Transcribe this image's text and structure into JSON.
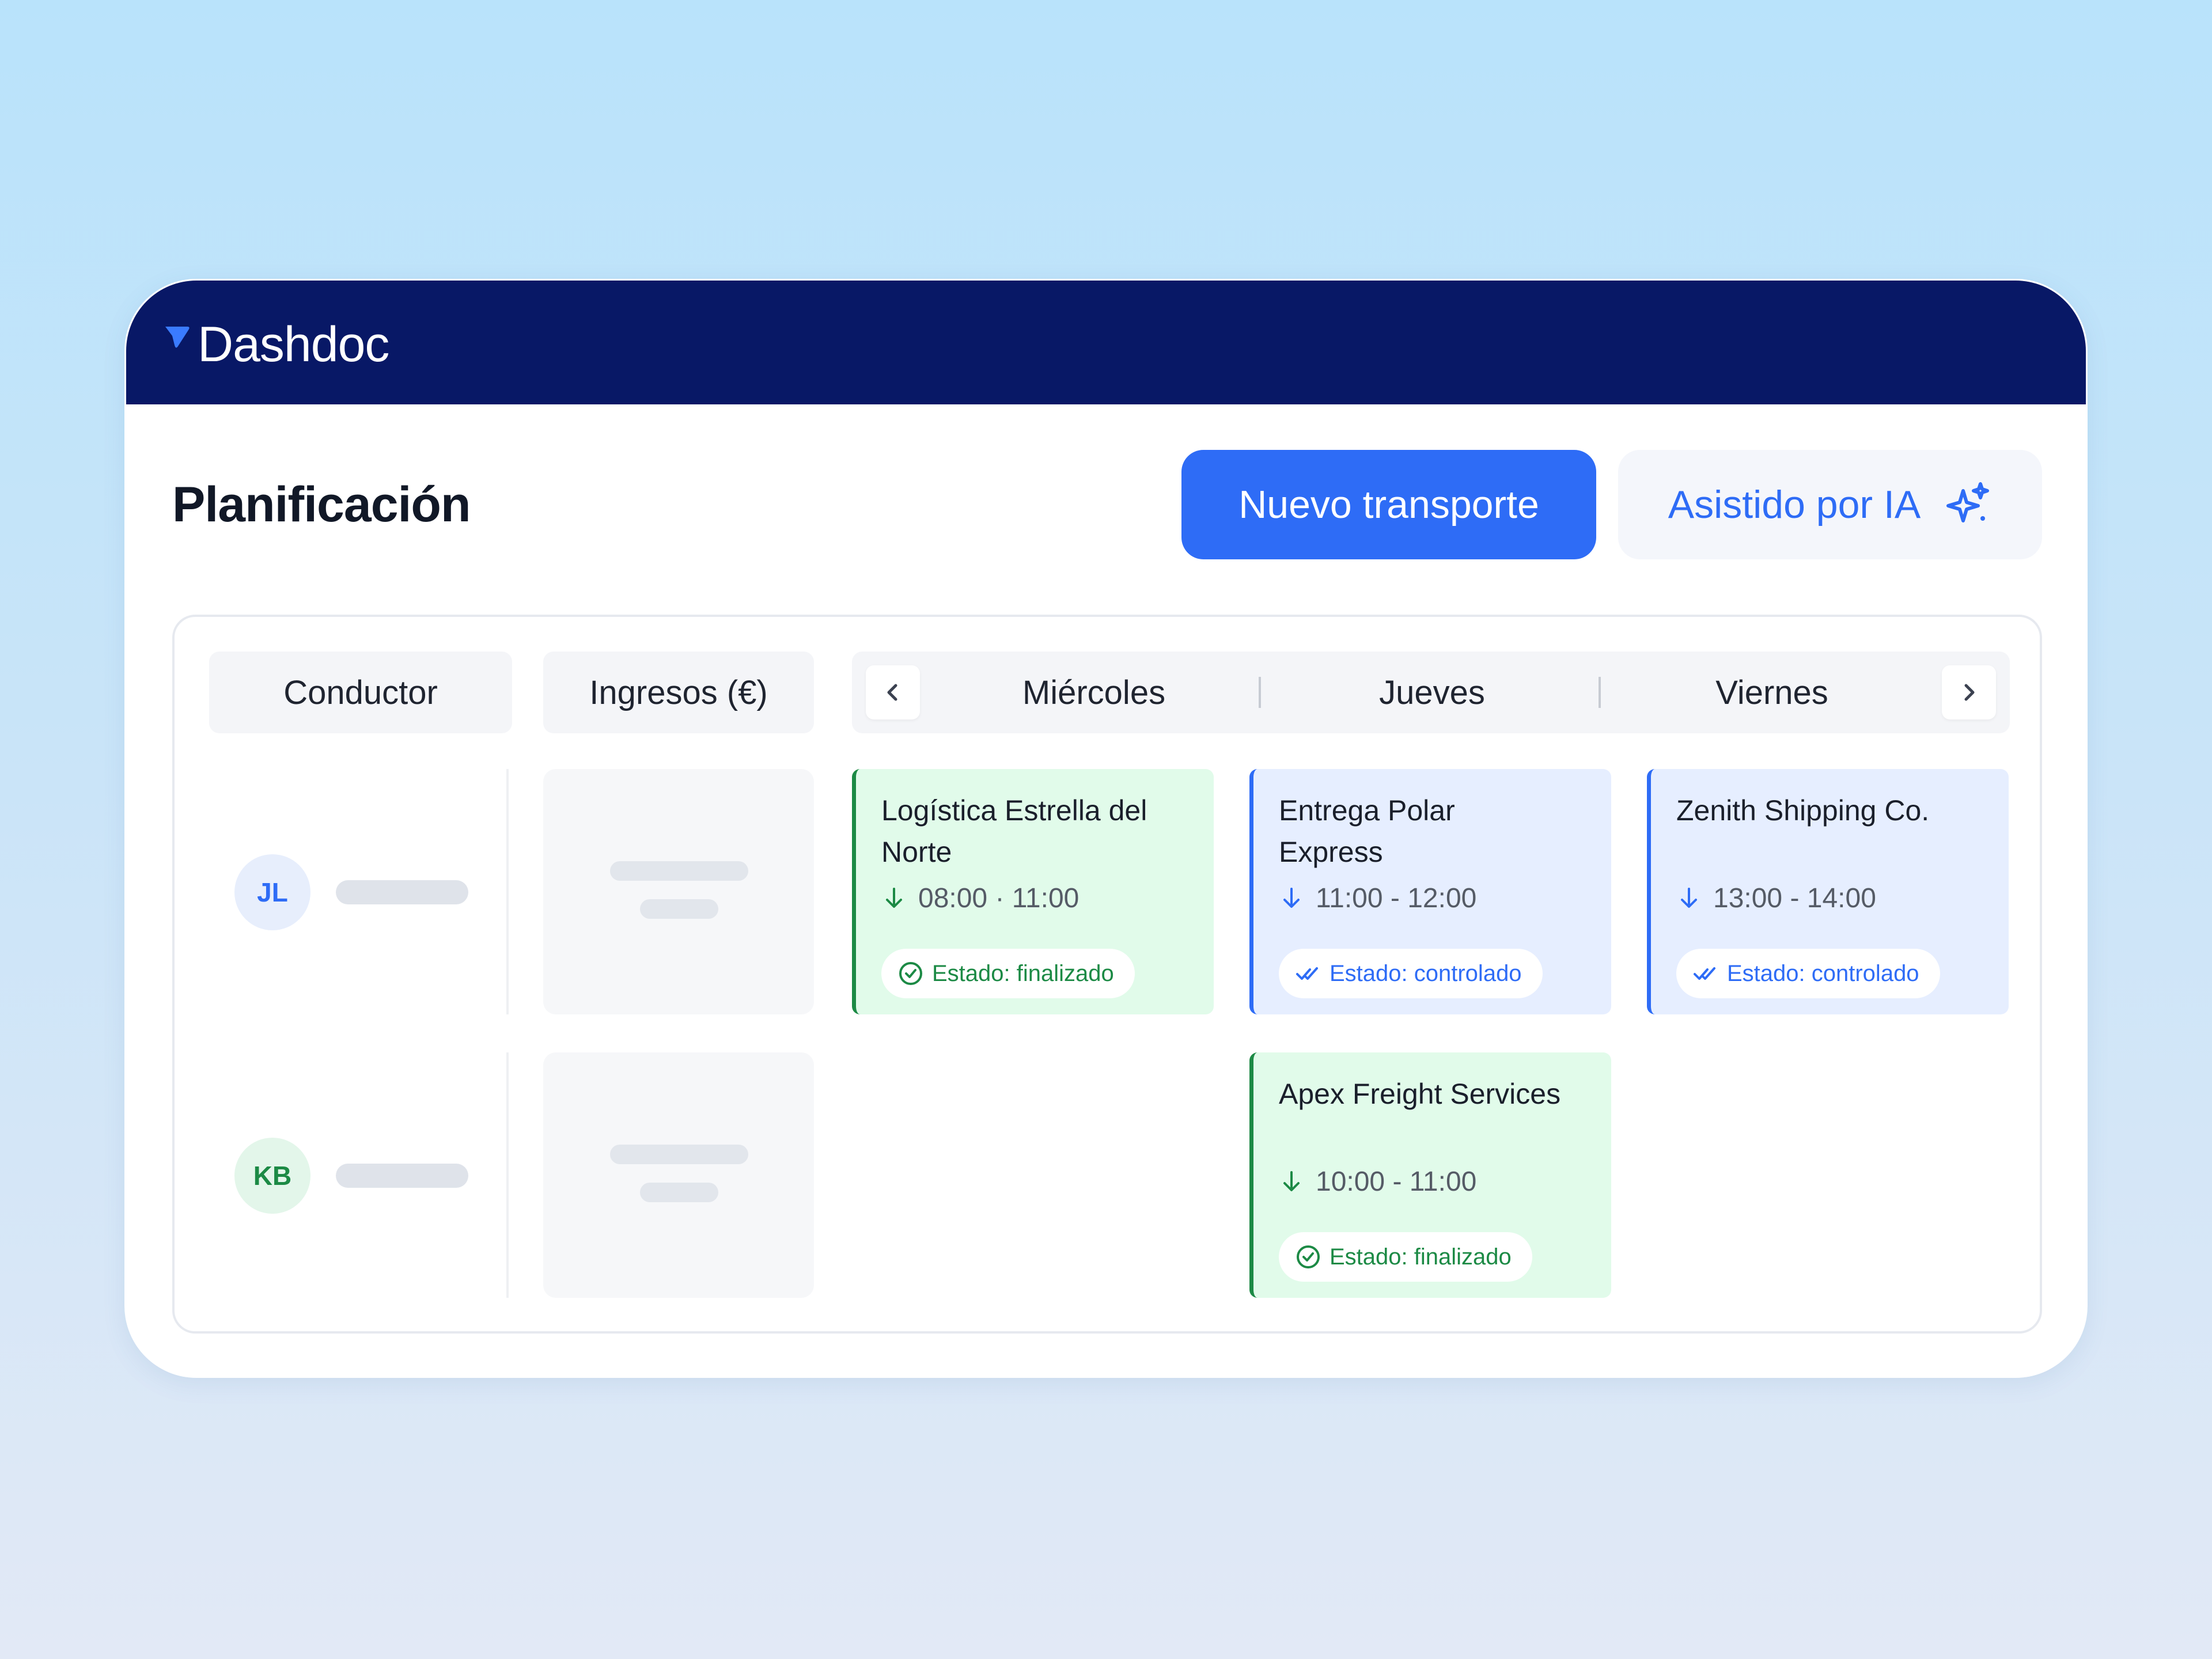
{
  "app": {
    "brand": "Dashdoc",
    "brand_color": "#081866",
    "accent_color": "#2e6cf6"
  },
  "header": {
    "title": "Planificación",
    "primary_button": "Nuevo transporte",
    "ai_button": "Asistido por IA",
    "ai_icon": "sparkle-icon"
  },
  "columns": {
    "driver": "Conductor",
    "revenue": "Ingresos (€)",
    "days": [
      "Miércoles",
      "Jueves",
      "Viernes"
    ],
    "prev_icon": "chevron-left-icon",
    "next_icon": "chevron-right-icon"
  },
  "rows": [
    {
      "initials": "JL",
      "cards": [
        {
          "day": "Miércoles",
          "title": "Logística Estrella del Norte",
          "time": "08:00 · 11:00",
          "status": "Estado: finalizado",
          "status_type": "finalizado"
        },
        {
          "day": "Jueves",
          "title": "Entrega Polar Express",
          "time": "11:00 - 12:00",
          "status": "Estado: controlado",
          "status_type": "controlado"
        },
        {
          "day": "Viernes",
          "title": "Zenith Shipping Co.",
          "time": "13:00 - 14:00",
          "status": "Estado: controlado",
          "status_type": "controlado"
        }
      ]
    },
    {
      "initials": "KB",
      "cards": [
        {
          "day": "Jueves",
          "title": "Apex Freight Services",
          "time": "10:00 - 11:00",
          "status": "Estado: finalizado",
          "status_type": "finalizado"
        }
      ]
    }
  ],
  "status_colors": {
    "finalizado": "#1c8a45",
    "controlado": "#2e6cf6"
  }
}
